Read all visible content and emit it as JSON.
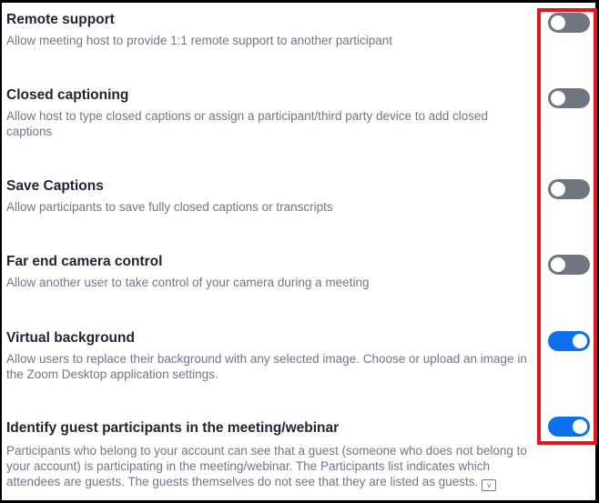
{
  "settings": [
    {
      "title": "Remote support",
      "description": "Allow meeting host to provide 1:1 remote support to another participant",
      "enabled": false
    },
    {
      "title": "Closed captioning",
      "description": "Allow host to type closed captions or assign a participant/third party device to add closed captions",
      "enabled": false
    },
    {
      "title": "Save Captions",
      "description": "Allow participants to save fully closed captions or transcripts",
      "enabled": false
    },
    {
      "title": "Far end camera control",
      "description": "Allow another user to take control of your camera during a meeting",
      "enabled": false
    },
    {
      "title": "Virtual background",
      "description": "Allow users to replace their background with any selected image. Choose or upload an image in the Zoom Desktop application settings.",
      "enabled": true
    },
    {
      "title": "Identify guest participants in the meeting/webinar",
      "description": "Participants who belong to your account can see that a guest (someone who does not belong to your account) is participating in the meeting/webinar. The Participants list indicates which attendees are guests. The guests themselves do not see that they are listed as guests.",
      "enabled": true,
      "info_icon": "info-icon"
    }
  ],
  "colors": {
    "toggle_on": "#0e71eb",
    "toggle_off": "#6e7680",
    "highlight_border": "#e8141e",
    "title_text": "#232333",
    "description_text": "#747487"
  }
}
